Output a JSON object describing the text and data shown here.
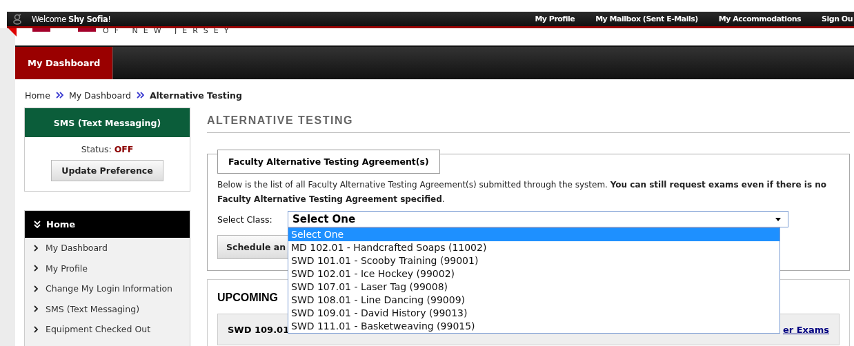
{
  "top_bar": {
    "welcome": "Welcome **Shy Sofia**!",
    "links": [
      "My Profile",
      "My Mailbox (Sent E-Mails)",
      "My Accommodations",
      "Sign Ou"
    ]
  },
  "logo": {
    "text": "OF NEW JERSEY"
  },
  "nav": {
    "tabs": [
      {
        "label": "My Dashboard",
        "selected": true
      }
    ]
  },
  "breadcrumb": [
    {
      "label": "Home",
      "current": false
    },
    {
      "label": "My Dashboard",
      "current": false
    },
    {
      "label": "Alternative Testing",
      "current": true
    }
  ],
  "sms_panel": {
    "title": "SMS (Text Messaging)",
    "status_label": "Status:",
    "status_value": "OFF",
    "button": "Update Preference"
  },
  "sidebar": {
    "title": "Home",
    "items": [
      "My Dashboard",
      "My Profile",
      "Change My Login Information",
      "SMS (Text Messaging)",
      "Equipment Checked Out"
    ]
  },
  "main": {
    "title": "ALTERNATIVE TESTING",
    "agreements": {
      "legend": "Faculty Alternative Testing Agreement(s)",
      "description": "Below is the list of all Faculty Alternative Testing Agreement(s) submitted through the system. **You can still request exams even if there is no Faculty Alternative Testing Agreement specified**.",
      "select_label": "Select Class:",
      "select_value": "Select One",
      "options": [
        {
          "label": "Select One",
          "selected": true
        },
        {
          "label": "MD 102.01 - Handcrafted Soaps (11002)",
          "selected": false
        },
        {
          "label": "SWD 101.01 - Scooby Training (99001)",
          "selected": false
        },
        {
          "label": "SWD 102.01 - Ice Hockey (99002)",
          "selected": false
        },
        {
          "label": "SWD 107.01 - Laser Tag (99008)",
          "selected": false
        },
        {
          "label": "SWD 108.01 - Line Dancing (99009)",
          "selected": false
        },
        {
          "label": "SWD 109.01 - David History (99013)",
          "selected": false
        },
        {
          "label": "SWD 111.01 - Basketweaving (99015)",
          "selected": false
        }
      ],
      "schedule_button": "Schedule an"
    },
    "upcoming": {
      "title": "UPCOMING",
      "exam": "SWD 109.01",
      "link": "er Exams"
    }
  }
}
